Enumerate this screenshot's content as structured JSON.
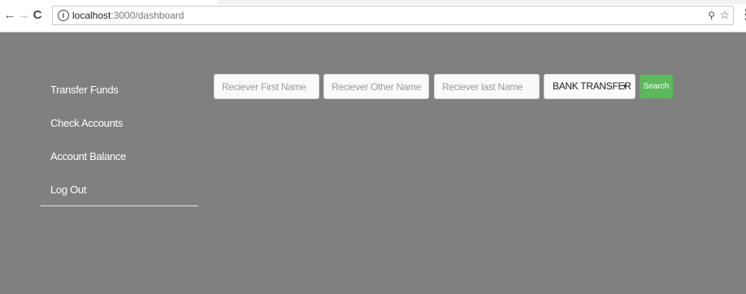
{
  "browser": {
    "url_host": "localhost",
    "url_path": ":3000/dashboard",
    "info_icon_text": "i"
  },
  "sidebar": {
    "items": [
      {
        "label": "Transfer Funds"
      },
      {
        "label": "Check Accounts"
      },
      {
        "label": "Account Balance"
      },
      {
        "label": "Log Out"
      }
    ]
  },
  "search": {
    "first_name_placeholder": "Reciever First Name",
    "other_names_placeholder": "Reciever Other Names",
    "last_name_placeholder": "Reciever last Name",
    "transfer_type_value": "BANK TRANSFER",
    "button_label": "Search"
  },
  "icons": {
    "back": "arrow-left-icon",
    "forward": "arrow-right-icon",
    "reload": "reload-icon",
    "info": "info-icon",
    "key": "key-icon",
    "bookmark": "star-icon",
    "menu": "kebab-menu-icon",
    "select_caret": "caret-down-icon"
  },
  "colors": {
    "page_background": "#808080",
    "search_button": "#5cb85c",
    "sidebar_text": "#ffffff"
  }
}
